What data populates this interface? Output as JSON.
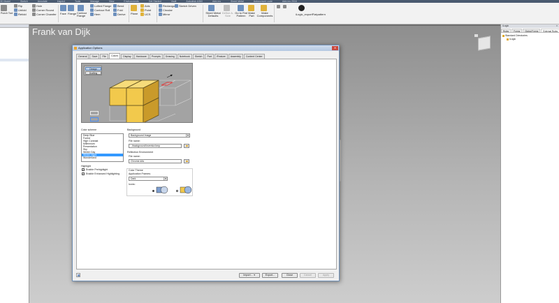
{
  "topstrip": {
    "tabs": [
      "3D Model",
      "Sketch",
      "Annotate",
      "Inspect",
      "Tools",
      "Manage",
      "View",
      "Environments",
      "Get Started",
      "Vault",
      "Autodesk A360",
      "Add-Ins",
      "Sheet Metal",
      "Autoconvert code",
      "Add-Ins 2016"
    ]
  },
  "ribbon": {
    "create_group": {
      "sketch_label": "Sketch",
      "face_label": "Face",
      "flange_label": "Flange",
      "contour_flange_label": "Contour Flange",
      "lofted_flange_label": "Lofted Flange",
      "contour_roll_label": "Contour Roll",
      "hem_label": "Hem",
      "bend_label": "Bend",
      "fold_label": "Fold",
      "derive_label": "Derive",
      "group_label": "Create"
    },
    "modify_group": {
      "rip_label": "Rip",
      "unfold_label": "Unfold",
      "refold_label": "Refold",
      "hole_label": "Hole",
      "corner_round_label": "Corner Round",
      "corner_chamfer_label": "Corner Chamfer",
      "punch_tool_label": "Punch Tool",
      "group_label": "Modify"
    },
    "work_features": {
      "plane_label": "Plane",
      "axis_label": "Axis",
      "point_label": "Point",
      "ucs_label": "UCS",
      "group_label": "Work Features"
    },
    "pattern": {
      "rectangular_label": "Rectangular",
      "circular_label": "Circular",
      "mirror_label": "Mirror",
      "sketch_driven_label": "Sketch Driven",
      "group_label": "Pattern"
    },
    "setup": {
      "sheet_metal_defaults_label": "Sheet Metal Defaults",
      "define_a_side_label": "Define A-Side",
      "go_to_flat_pattern_label": "Go to Flat Pattern",
      "make_part_label": "Make Part",
      "make_components_label": "Make Components"
    },
    "addin": {
      "command_label": "iLogic_exportFlatpattern"
    }
  },
  "graphics": {
    "title": "Frank van Dijk"
  },
  "browser": {
    "header": "iLogic",
    "tabs": [
      "Rules",
      "Forms",
      "Global Forms",
      "External Rules"
    ],
    "active_tab": "External Rules",
    "tree": {
      "root": "Standard Directories",
      "child": "iLogic"
    }
  },
  "dialog": {
    "title": "Application Options",
    "close_glyph": "✕",
    "tabs": [
      "General",
      "Save",
      "File",
      "Colors",
      "Display",
      "Hardware",
      "Prompts",
      "Drawing",
      "Notebook",
      "Sketch",
      "Part",
      "iFeature",
      "Assembly",
      "Content Center"
    ],
    "active_tab": "Colors",
    "preview": {
      "design_label": "Design",
      "drafting_label": "Drafting"
    },
    "color_scheme": {
      "label": "Color scheme",
      "items": [
        "Deep Blue",
        "Forest",
        "High Contrast",
        "Millennium",
        "Presentation",
        "Sky",
        "Winter Day",
        "Winter Night",
        "Wonderland"
      ],
      "selected": "Winter Night"
    },
    "highlight": {
      "label": "Highlight",
      "enable_prehighlight": "Enable Prehighlight",
      "enable_enhanced": "Enable Enhanced Highlighting",
      "check_glyph": "✓"
    },
    "background": {
      "label": "Background",
      "type_value": "Background Image",
      "file_name_label": "File name:",
      "file_name_value": "..\\background\\inventor.bmp"
    },
    "reflection": {
      "label": "Reflection Environment",
      "file_name_label": "File name:",
      "file_name_value": "Chrome.dds"
    },
    "color_theme": {
      "label": "Color Theme",
      "app_frames_label": "Application Frames:",
      "app_frames_value": "Dark",
      "icons_label": "Icons:"
    },
    "dropdown_glyph": "▼",
    "footer": {
      "import_label": "Import...",
      "export_label": "Export...",
      "close_label": "Close",
      "cancel_label": "Cancel",
      "apply_label": "Apply"
    }
  },
  "colors": {
    "accent": "#3399ff",
    "cube_face": "#f2c94c",
    "selection": "#e23b3b"
  }
}
